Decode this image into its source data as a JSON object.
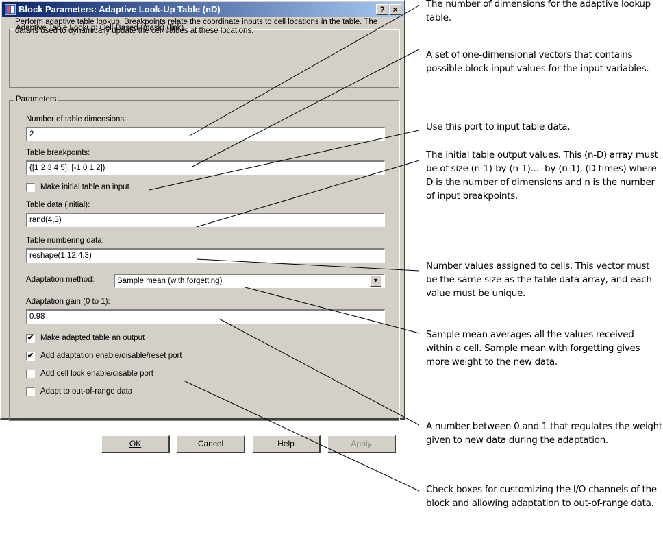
{
  "window": {
    "title": "Block Parameters: Adaptive Look-Up Table (nD)",
    "help_button": "?",
    "close_button": "×"
  },
  "mask": {
    "group_title": "Adaptive Table Lookup: Cell-Based (mask) (link)",
    "description": "Perform adaptive table lookup.  Breakpoints relate the coordinate inputs to cell locations in the table.  The data is used to dynamically update the cell values at these locations."
  },
  "parameters": {
    "group_title": "Parameters",
    "num_dims_label": "Number of table dimensions:",
    "num_dims_value": "2",
    "breakpoints_label": "Table breakpoints:",
    "breakpoints_value": "{[1 2 3 4 5], [-1 0 1 2]}",
    "make_initial_input_label": "Make initial table an input",
    "make_initial_input_checked": "",
    "table_data_label": "Table data (initial):",
    "table_data_value": "rand(4,3)",
    "numbering_label": "Table numbering data:",
    "numbering_value": "reshape(1:12,4,3)",
    "adaptation_method_label": "Adaptation method:",
    "adaptation_method_value": "Sample mean (with forgetting)",
    "adaptation_gain_label": "Adaptation gain (0 to 1):",
    "adaptation_gain_value": "0.98",
    "checkboxes": [
      {
        "label": "Make adapted table an output",
        "mark": "✔"
      },
      {
        "label": "Add adaptation enable/disable/reset port",
        "mark": "✔"
      },
      {
        "label": "Add cell lock enable/disable port",
        "mark": ""
      },
      {
        "label": "Adapt to out-of-range data",
        "mark": ""
      }
    ]
  },
  "buttons": {
    "ok": "OK",
    "cancel": "Cancel",
    "help": "Help",
    "apply": "Apply"
  },
  "annotations": [
    "The number of dimensions for the adaptive lookup table.",
    "A set of one-dimensional vectors that contains possible block input values for the input variables.",
    "Use this port to input table data.",
    "The initial table output values. This (n-D) array must be of size (n-1)-by-(n-1)... -by-(n-1), (D times) where D is the number of dimensions and n is the number of input breakpoints.",
    "Number values assigned to cells. This vector must be the same size as the table data array, and each value must be unique.",
    "Sample mean averages all the values received within a cell. Sample mean with forgetting gives more weight to the new data.",
    "A number between 0 and 1 that regulates the weight given to new data during the adaptation.",
    "Check boxes for customizing the I/O channels of the block and allowing adaptation to out-of-range data."
  ],
  "colors": {
    "title_bar_start": "#0a246a",
    "title_bar_end": "#a6caf0",
    "dialog_face": "#d4d0c8"
  }
}
